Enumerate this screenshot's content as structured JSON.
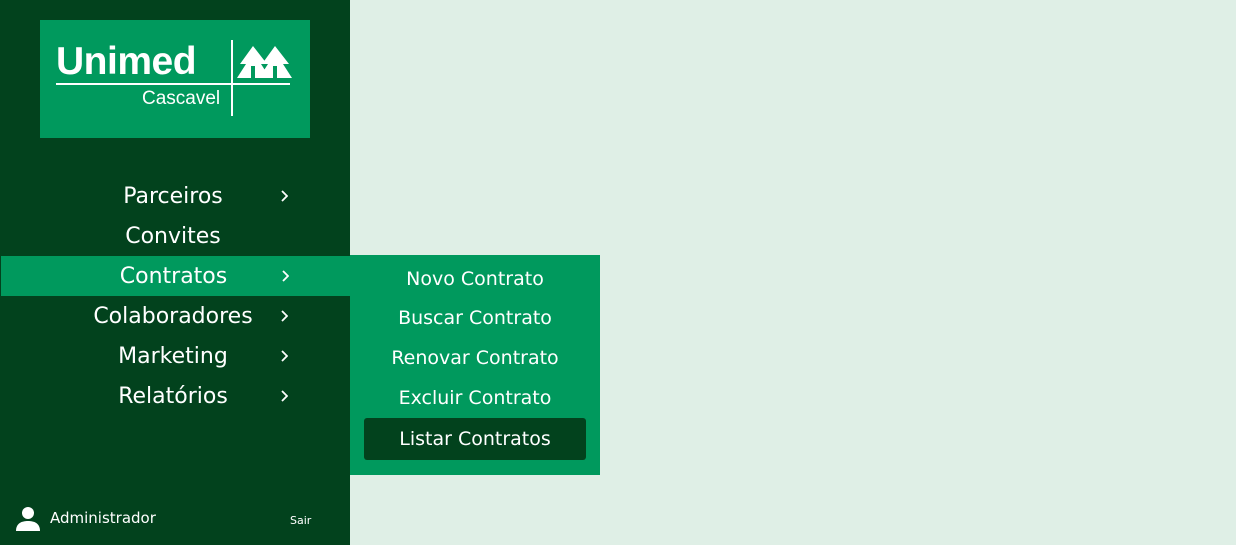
{
  "brand": {
    "name": "Unimed",
    "subtitle": "Cascavel"
  },
  "colors": {
    "sidebar_bg": "#02421d",
    "accent": "#00995d",
    "page_bg": "#dfefe6"
  },
  "sidebar": {
    "items": [
      {
        "label": "Parceiros",
        "has_submenu": true,
        "icon": "chevron-right-icon"
      },
      {
        "label": "Convites",
        "has_submenu": false
      },
      {
        "label": "Contratos",
        "has_submenu": true,
        "icon": "chevron-right-icon",
        "active": true
      },
      {
        "label": "Colaboradores",
        "has_submenu": true,
        "icon": "chevron-right-icon"
      },
      {
        "label": "Marketing",
        "has_submenu": true,
        "icon": "chevron-right-icon"
      },
      {
        "label": "Relatórios",
        "has_submenu": true,
        "icon": "chevron-right-icon"
      }
    ]
  },
  "submenu": {
    "items": [
      {
        "label": "Novo Contrato"
      },
      {
        "label": "Buscar Contrato"
      },
      {
        "label": "Renovar Contrato"
      },
      {
        "label": "Excluir Contrato"
      },
      {
        "label": "Listar Contratos",
        "selected": true
      }
    ]
  },
  "footer": {
    "user_name": "Administrador",
    "user_icon": "user-icon",
    "logout_label": "Sair"
  }
}
